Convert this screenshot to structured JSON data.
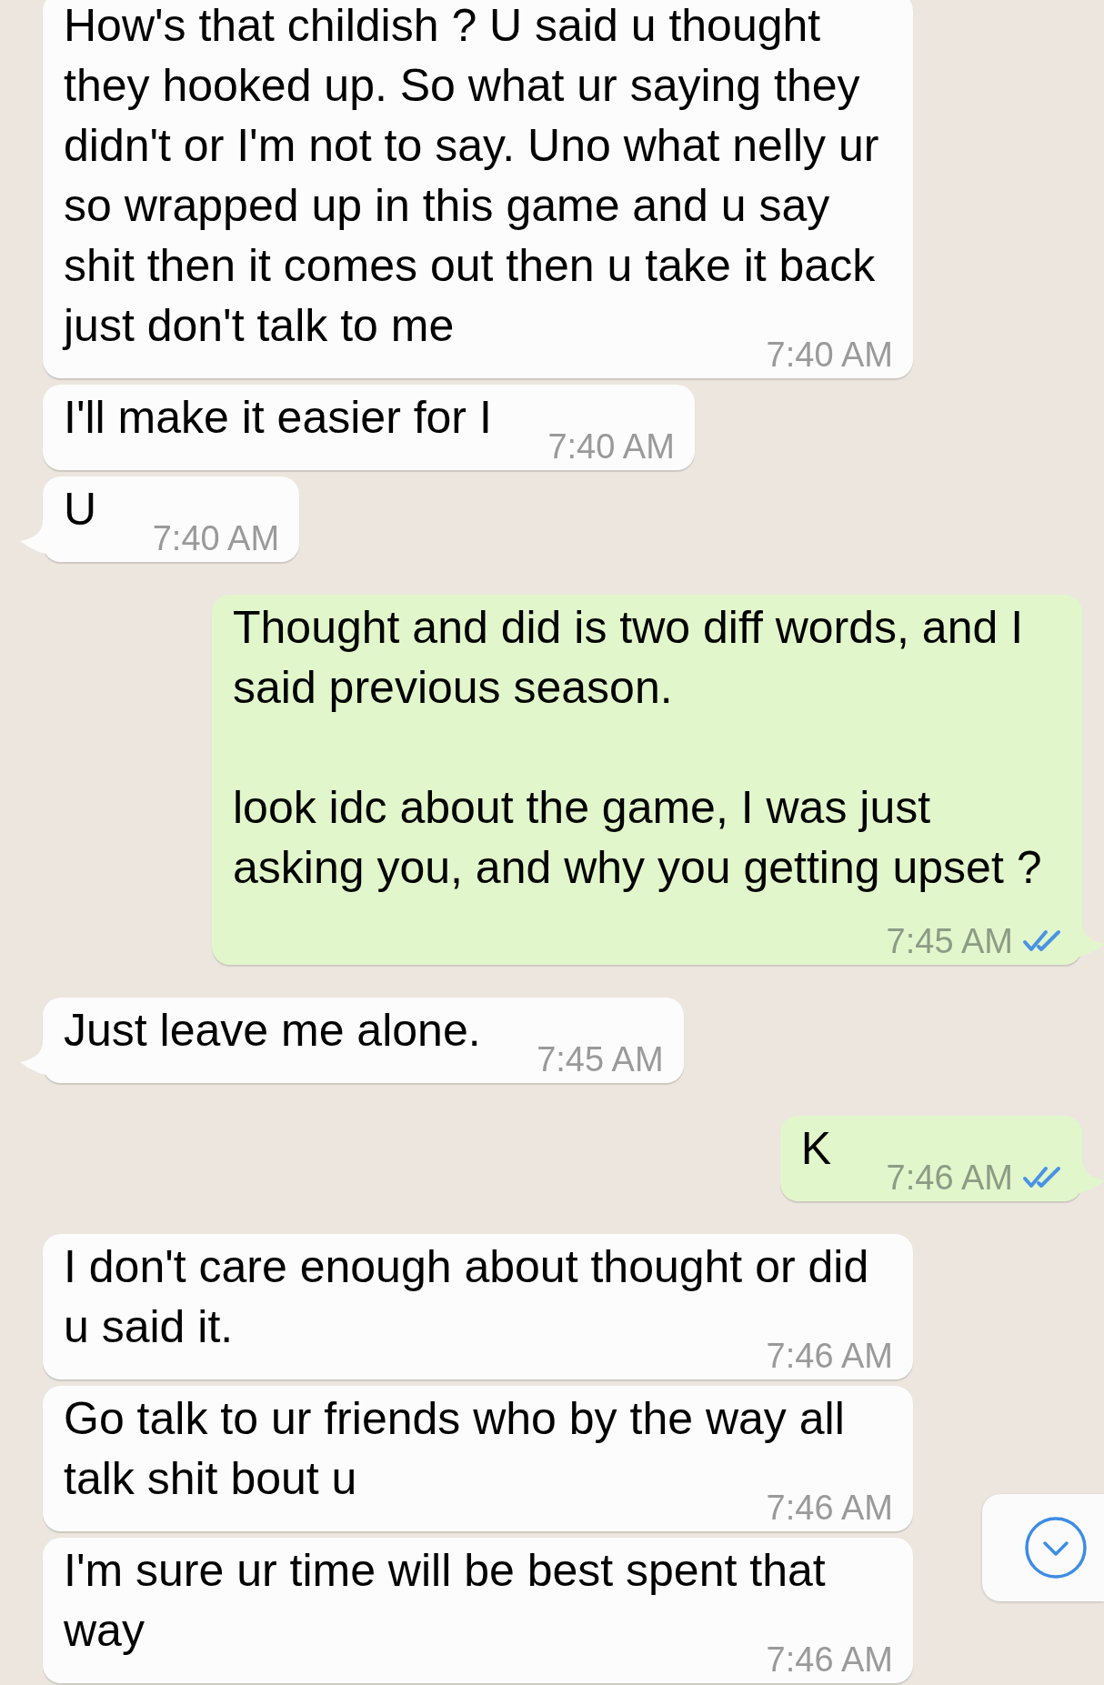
{
  "messages": [
    {
      "kind": "incoming",
      "text": "How's that childish ? U said u thought they hooked up. So what ur saying they didn't or I'm not to say. Uno what nelly ur so wrapped up in this game and u say shit then it comes out then u take it back just don't talk to me",
      "time": "7:40 AM"
    },
    {
      "kind": "incoming",
      "text": "I'll make it easier for I",
      "time": "7:40 AM"
    },
    {
      "kind": "incoming",
      "text": "U",
      "time": "7:40 AM"
    },
    {
      "kind": "outgoing",
      "text": "Thought and did is two diff words, and I said previous season.\n\nlook idc about the game, I was just asking you, and why you getting upset ?",
      "time": "7:45 AM",
      "read": true
    },
    {
      "kind": "incoming",
      "text": "Just leave me alone.",
      "time": "7:45 AM"
    },
    {
      "kind": "outgoing",
      "text": "K",
      "time": "7:46 AM",
      "read": true
    },
    {
      "kind": "incoming",
      "text": "I don't care enough about thought or did u said it.",
      "time": "7:46 AM"
    },
    {
      "kind": "incoming",
      "text": "Go talk to ur friends who by the way all talk shit bout u",
      "time": "7:46 AM"
    },
    {
      "kind": "incoming",
      "text": "I'm sure ur time will be best spent that way",
      "time": "7:46 AM"
    }
  ],
  "scroll_down_button": {
    "visible": true
  }
}
